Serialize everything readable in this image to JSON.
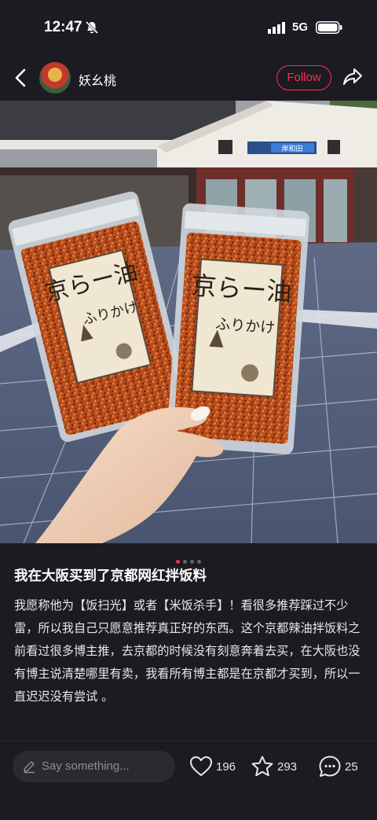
{
  "status_bar": {
    "time": "12:47",
    "network": "5G",
    "icons": [
      "bell-mute-icon",
      "signal-icon",
      "battery-icon"
    ]
  },
  "header": {
    "username": "妖幺桃",
    "follow_label": "Follow",
    "icons": [
      "back-icon",
      "share-icon"
    ]
  },
  "photo": {
    "sign_text": "岸和田",
    "package_title": "京らー油",
    "package_subtitle": "ふりかけ"
  },
  "carousel": {
    "total": 4,
    "active": 1
  },
  "post": {
    "title": "我在大阪买到了京都网红拌饭料",
    "body": "我愿称他为【饭扫光】或者【米饭杀手】！看很多推荐踩过不少雷，所以我自己只愿意推荐真正好的东西。这个京都辣油拌饭料之前看过很多博主推，去京都的时候没有刻意奔着去买，在大阪也没有博主说清楚哪里有卖，我看所有博主都是在京都才买到，所以一直迟迟没有尝试 。"
  },
  "bottom_bar": {
    "comment_placeholder": "Say something...",
    "likes": "196",
    "collects": "293",
    "comments": "25"
  },
  "colors": {
    "accent": "#ff2e4d",
    "background": "#1c1b22"
  }
}
